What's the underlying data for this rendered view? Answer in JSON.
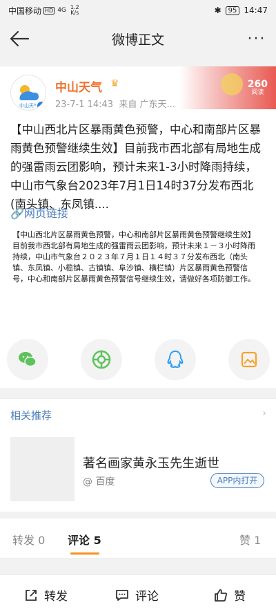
{
  "status_bar": {
    "carrier": "中国移动",
    "hd": "HD",
    "signal": "4G",
    "speed_value": "1.2",
    "speed_unit": "K/s",
    "battery": "95",
    "time": "14:47"
  },
  "nav": {
    "title": "微博正文",
    "more": "···"
  },
  "post": {
    "author": "中山天气",
    "avatar_caption": "中山天气",
    "timestamp": "23-7-1 14:43",
    "source": "来自 广东天...",
    "banner_count": "260",
    "banner_label": "阅读",
    "text": "【中山西北片区暴雨黄色预警，中心和南部片区暴雨黄色预警继续生效】目前我市西北部有局地生成的强雷雨云团影响，预计未来1-3小时降雨持续，中山市气象台2023年7月1日14时37分发布西北(南头镇、东凤镇....",
    "link_text": "网页链接",
    "image_text": "【中山西北片区暴雨黄色预警，中心和南部片区暴雨黄色预警继续生效】目前我市西北部有局地生成的强雷雨云团影响，预计未来１－３小时降雨持续，中山市气象台２０２３年７月１日１４时３７分发布西北（南头镇、东凤镇、小榄镇、古镇镇、阜沙镇、横栏镇）片区暴雨黄色预警信号，中心和南部片区暴雨黄色预警信号继续生效，请做好各项防御工作。"
  },
  "related": {
    "header": "相关推荐",
    "chevron": "›",
    "title": "著名画家黄永玉先生逝世",
    "source": "@ 百度",
    "open_app": "APP内打开"
  },
  "tabs": {
    "repost": "转发 0",
    "comment": "评论 5",
    "like": "赞 1"
  },
  "bottom": {
    "repost": "转发",
    "comment": "评论",
    "like": "赞"
  },
  "colors": {
    "accent": "#f7901e",
    "author": "#f0702a",
    "link": "#4a7cb8"
  }
}
